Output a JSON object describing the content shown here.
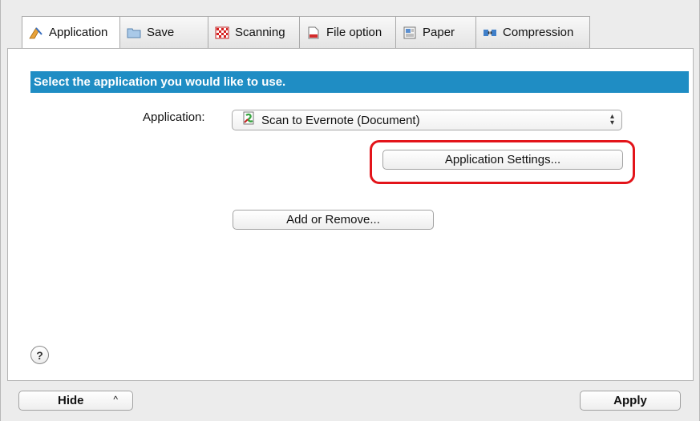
{
  "tabs": [
    {
      "label": "Application",
      "icon": "application-icon",
      "active": true
    },
    {
      "label": "Save",
      "icon": "folder-icon",
      "active": false
    },
    {
      "label": "Scanning",
      "icon": "scanning-icon",
      "active": false
    },
    {
      "label": "File option",
      "icon": "file-icon",
      "active": false
    },
    {
      "label": "Paper",
      "icon": "paper-icon",
      "active": false
    },
    {
      "label": "Compression",
      "icon": "compression-icon",
      "active": false
    }
  ],
  "banner": "Select the application you would like to use.",
  "application": {
    "label": "Application:",
    "selected": "Scan to Evernote (Document)",
    "icon": "evernote-icon"
  },
  "buttons": {
    "app_settings": "Application Settings...",
    "add_remove": "Add or Remove...",
    "hide": "Hide",
    "apply": "Apply"
  },
  "help": "?",
  "colors": {
    "banner": "#1f8dc4",
    "highlight": "#e3141a"
  }
}
